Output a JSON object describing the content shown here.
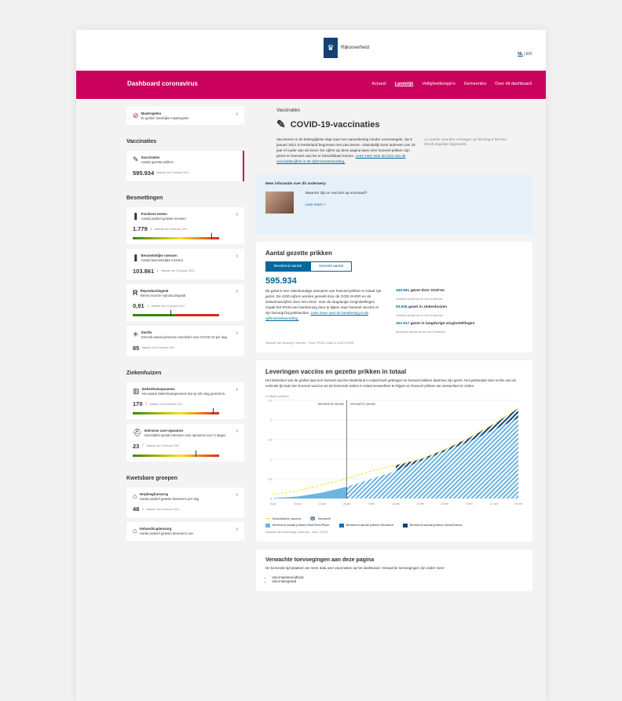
{
  "header": {
    "logo_text": "Rijksoverheid",
    "lang": {
      "nl": "NL",
      "sep": "|",
      "en": "EN"
    }
  },
  "nav": {
    "title": "Dashboard coronavirus",
    "links": [
      "Actueel",
      "Landelijk",
      "Veiligheidsregio's",
      "Gemeentes",
      "Over dit dashboard"
    ],
    "active": 1
  },
  "sidebar": {
    "maatregelen": {
      "title": "Maatregelen",
      "sub": "Er gelden landelijke maatregelen"
    },
    "vaccinaties_head": "Vaccinaties",
    "vaccinaties": {
      "title": "Vaccinaties",
      "sub": "Aantal gezette prikken",
      "value": "595.934",
      "date": "Waarde van 9 februari 2021"
    },
    "besmettingen_head": "Besmettingen",
    "positieve": {
      "title": "Positieve testen",
      "sub": "Aantal positief geteste mensen",
      "value": "1.779",
      "date": "Waarde van 9 februari 2021"
    },
    "besmettelijk": {
      "title": "Besmettelijke mensen",
      "sub": "Aantal besmettelijke mensen",
      "value": "103.861",
      "date": "Waarde van 28 januari 2021"
    },
    "reproductie": {
      "title": "Reproductiegetal",
      "sub": "Meest recente reproductiegetal",
      "value": "0,91",
      "date": "Waarde van 22 januari 2021"
    },
    "sterfte": {
      "title": "Sterfte",
      "sub": "Gemeld aantal personen overleden aan COVID-19 per dag",
      "value": "85",
      "date": "Waarde van 9 februari 2021"
    },
    "ziekenhuizen_head": "Ziekenhuizen",
    "zkh": {
      "title": "Ziekenhuisopnames",
      "sub": "Het aantal ziekenhuisopnames dat op één dag gemeld is.",
      "value": "170",
      "date": "Waarde van 8 februari 2021"
    },
    "ic": {
      "title": "Intensive care-opnames",
      "sub": "Gemiddeld aantal intensive care-opnames over 3 dagen",
      "value": "23",
      "date": "Waarde van 9 februari 2021"
    },
    "kwetsbaar_head": "Kwetsbare groepen",
    "verpleeg": {
      "title": "Verpleeghuiszorg",
      "sub": "Aantal positief geteste bewoners per dag",
      "value": "48",
      "date": "Waarde van 8 februari 2021"
    },
    "gehandicapt": {
      "title": "Gehandicaptenzorg",
      "sub": "Aantal positief geteste bewoners van"
    }
  },
  "main": {
    "crumb": "Vaccinaties",
    "title": "COVID-19-vaccinaties",
    "intro": "Vaccineren is de belangrijkste stap naar een samenleving zonder coronaregels. Op 6 januari 2021 is Nederland begonnen met vaccineren. Uiteindelijk komt iedereen van 18 jaar of ouder aan de beurt. De cijfers op deze pagina laten zien hoeveel prikken zijn gezet en hoeveel vaccins er beschikbaar komen.",
    "intro_link": "Lees meer over de bron van de vaccinatiecijfers in de cijferverantwoording.",
    "note": "Laatste waardes verkregen op dinsdag 9 februari. Wordt dagelijks bijgewerkt.",
    "info": {
      "head": "Meer informatie over dit onderwerp",
      "q": "Waarom zijn er vaccins op voorraad?",
      "link": "Lees meer >"
    },
    "prikken": {
      "title": "Aantal gezette prikken",
      "tab1": "Berekend aantal",
      "tab2": "Gemeld aantal",
      "value": "595.934",
      "text": "Dit getal is een rekenkundige aanname van hoeveel prikken in totaal zijn gezet. De GGD-cijfers worden gemeld door de GGD-GHOR en de ziekenhuiscijfers door het LNAZ. Voor de langdurige zorginstellingen maakt het RIVM een berekening door te kijken naar hoeveel vaccins er zijn bezorgd bij prikloacties.",
      "link": "Lees meer over de berekening in de cijferverantwoording.",
      "s1a": "340.661",
      "s1b": "gezet door GGD'en",
      "s1c": "Gemeld aantal tot en met 8 februari",
      "s2a": "93.836",
      "s2b": "gezet in ziekenhuizen",
      "s2c": "Gemeld aantal tot en met 8 februari",
      "s3a": "161.517",
      "s3b": "gezet in langdurige zorginstellingen",
      "s3c": "Berekend aantal tot en met 8 februari",
      "source": "Waarde van dinsdag 9 februari · Bron: RIVM, LNAZ & GGD-GHOR"
    },
    "leveringen": {
      "title": "Leveringen vaccins en gezette prikken in totaal",
      "desc": "Het linkerdeel van de grafiek laat zien hoeveel vaccins Nederland in totaal heeft gekregen en hoeveel prikken daarmee zijn gezet. Het gestreepte deel rechts van de verticale lijn laat zien hoeveel vaccins we de komende weken in totaal verwachten te krijgen en hoeveel prikken we verwachten te zetten.",
      "yunit": "x miljoen prikken",
      "label_left": "Berekend aantal",
      "label_right": "Verwacht aantal",
      "leg1": "Beschikbare vaccins",
      "leg2": "Verwacht",
      "leg3": "Berekend aantal prikken BioNTech/Pfizer",
      "leg4": "Berekend aantal prikken Moderna",
      "leg5": "Berekend aantal prikken AstraZeneca",
      "source": "Waarde van woensdag 3 februari · Bron: RIVM"
    },
    "verwacht": {
      "title": "Verwachte toevoegingen aan deze pagina",
      "text": "De komende tijd plaatsen we meer data over vaccinaties op het dashboard. Verwachte toevoegingen zijn onder meer:",
      "b1": "Vaccinatiebereidheid",
      "b2": "Vaccinatiegraad"
    }
  },
  "chart_data": {
    "type": "area",
    "x": [
      "8 jan",
      "15 jan",
      "22 jan",
      "29 jan",
      "5 feb",
      "12 feb",
      "19 feb",
      "26 feb",
      "5 mrt",
      "12 mrt",
      "19 mrt"
    ],
    "ylim": [
      0,
      2.5
    ],
    "series": [
      {
        "name": "Beschikbare vaccins",
        "values": [
          0.1,
          0.2,
          0.35,
          0.5,
          0.7,
          0.85,
          1.0,
          1.25,
          1.55,
          1.9,
          2.3
        ]
      },
      {
        "name": "Berekend aantal prikken BioNTech/Pfizer",
        "values": [
          0.01,
          0.05,
          0.15,
          0.3,
          0.5,
          0.7,
          0.95,
          1.2,
          1.45,
          1.75,
          2.05
        ]
      }
    ],
    "colors": {
      "vaccins": "#f9e11e",
      "pfizer": "#6cb4e2",
      "moderna": "#1a6fb8",
      "astra": "#154273"
    }
  }
}
